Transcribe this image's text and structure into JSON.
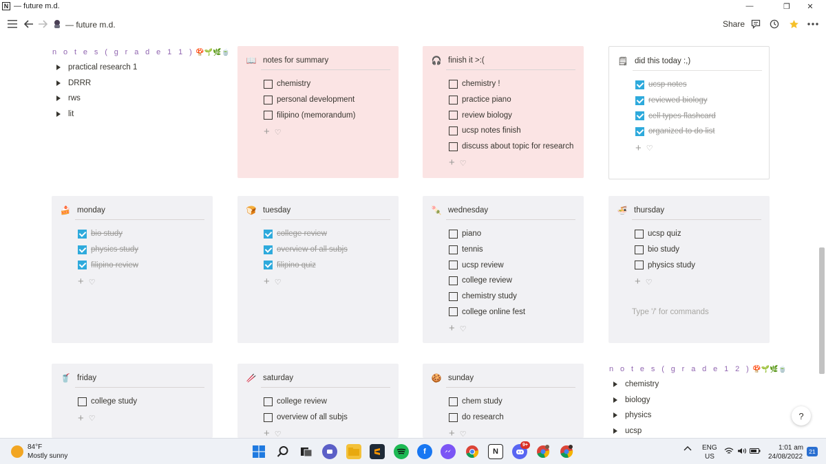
{
  "window": {
    "title": "— future m.d.",
    "controls": [
      "—",
      "❐",
      "✕"
    ]
  },
  "topbar": {
    "page_title": "— future m.d.",
    "share_label": "Share"
  },
  "notes_grade11": {
    "heading": "n o t e s  ( g r a d e 1 1 )",
    "emojis": "🍄🌱🌿🍵",
    "items": [
      "practical research 1",
      "DRRR",
      "rws",
      "lit"
    ]
  },
  "notes_grade12": {
    "heading": "n o t e s  ( g r a d e 1 2 )",
    "emojis": "🍄🌱🌿🍵",
    "items": [
      "chemistry",
      "biology",
      "physics",
      "ucsp"
    ]
  },
  "callouts": {
    "summary": {
      "icon": "📖",
      "title": "notes for summary",
      "items": [
        {
          "text": "chemistry",
          "done": false
        },
        {
          "text": "personal development",
          "done": false
        },
        {
          "text": "filipino (memorandum)",
          "done": false
        }
      ],
      "add": "♡"
    },
    "finish": {
      "icon": "🎧",
      "title": "finish it >:(",
      "items": [
        {
          "text": "chemistry !",
          "done": false
        },
        {
          "text": "practice piano",
          "done": false
        },
        {
          "text": "review biology",
          "done": false
        },
        {
          "text": "ucsp notes finish",
          "done": false
        },
        {
          "text": "discuss about topic for research",
          "done": false
        }
      ],
      "add": "♡"
    },
    "today": {
      "icon": "🗒",
      "title": "did this today :,)",
      "items": [
        {
          "text": "ucsp notes",
          "done": true
        },
        {
          "text": "reviewed biology",
          "done": true
        },
        {
          "text": "cell types flashcard",
          "done": true
        },
        {
          "text": "organized to do list",
          "done": true
        }
      ],
      "add": "♡"
    },
    "monday": {
      "icon": "🍰",
      "title": "monday",
      "items": [
        {
          "text": "bio study",
          "done": true
        },
        {
          "text": "physics study",
          "done": true
        },
        {
          "text": "filipino review",
          "done": true
        }
      ],
      "add": "♡"
    },
    "tuesday": {
      "icon": "🍞",
      "title": "tuesday",
      "items": [
        {
          "text": "college review",
          "done": true
        },
        {
          "text": "overview of all subjs",
          "done": true
        },
        {
          "text": "filipino quiz",
          "done": true
        }
      ],
      "add": "♡"
    },
    "wednesday": {
      "icon": "🍡",
      "title": "wednesday",
      "items": [
        {
          "text": "piano",
          "done": false
        },
        {
          "text": "tennis",
          "done": false
        },
        {
          "text": "ucsp review",
          "done": false
        },
        {
          "text": "college review",
          "done": false
        },
        {
          "text": "chemistry study",
          "done": false
        },
        {
          "text": "college online fest",
          "done": false
        }
      ],
      "add": "♡"
    },
    "thursday": {
      "icon": "🍜",
      "title": "thursday",
      "items": [
        {
          "text": "ucsp quiz",
          "done": false
        },
        {
          "text": "bio study",
          "done": false
        },
        {
          "text": "physics study",
          "done": false
        }
      ],
      "add": "♡",
      "placeholder": "Type '/' for commands"
    },
    "friday": {
      "icon": "🥤",
      "title": "friday",
      "items": [
        {
          "text": "college study",
          "done": false
        }
      ],
      "add": "♡"
    },
    "saturday": {
      "icon": "🥢",
      "title": "saturday",
      "items": [
        {
          "text": "college review",
          "done": false
        },
        {
          "text": "overview of all subjs",
          "done": false
        }
      ],
      "add": "♡"
    },
    "sunday": {
      "icon": "🍪",
      "title": "sunday",
      "items": [
        {
          "text": "chem study",
          "done": false
        },
        {
          "text": "do research",
          "done": false
        }
      ],
      "add": "♡"
    }
  },
  "help_label": "?",
  "taskbar": {
    "temperature": "84°F",
    "weather": "Mostly sunny",
    "lang": "ENG",
    "region": "US",
    "time": "1:01 am",
    "date": "24/08/2022",
    "notification_count": "21",
    "discord_badge": "9+"
  },
  "colors": {
    "pink_callout": "#fbe4e4",
    "gray_callout": "#f1f1f4",
    "checkbox_checked": "#2eaadc",
    "heading_purple": "#9065b0"
  }
}
